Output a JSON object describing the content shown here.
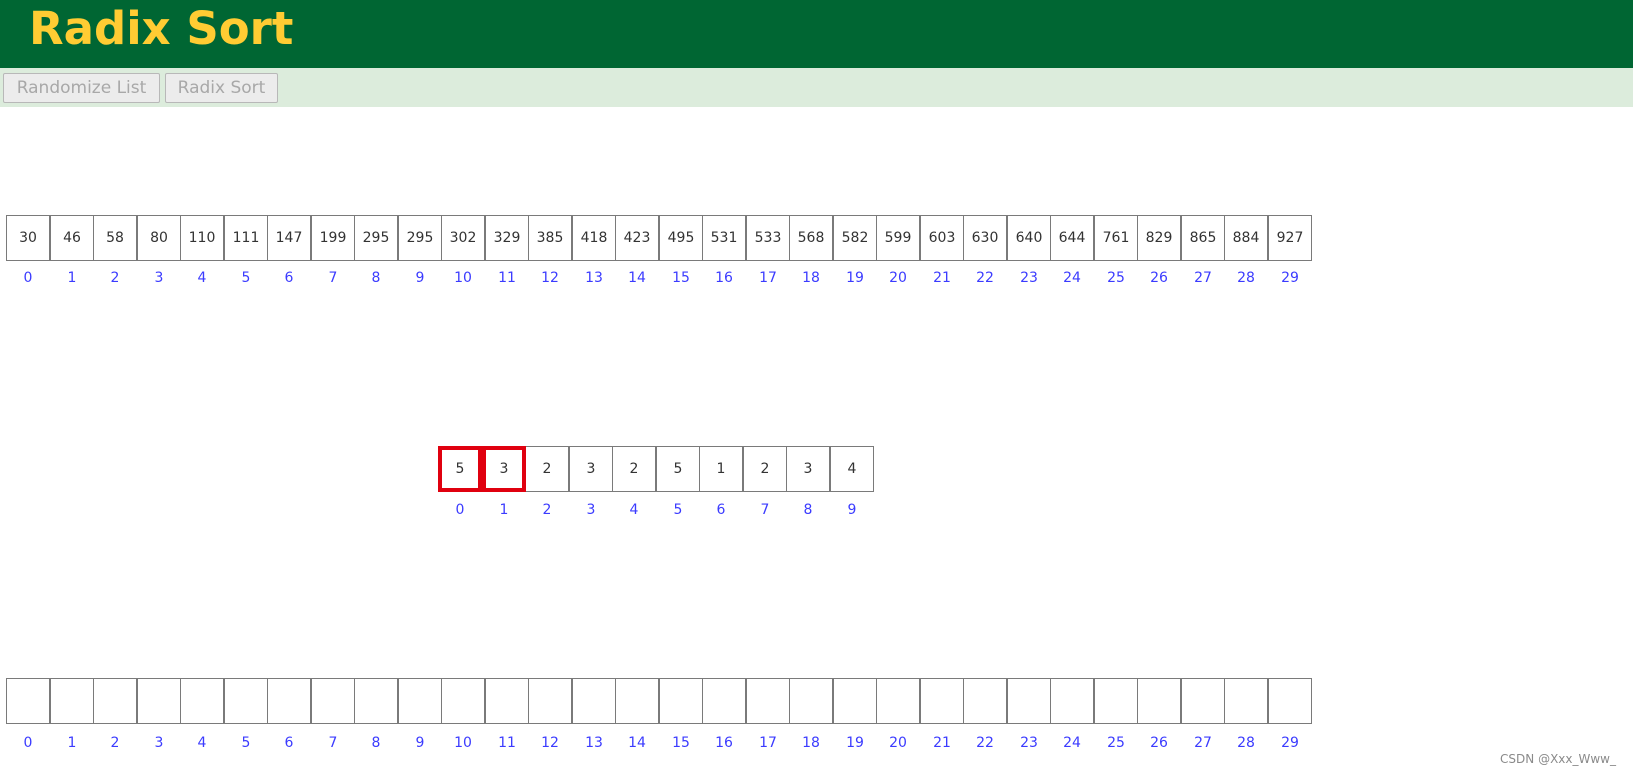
{
  "header": {
    "title": "Radix Sort"
  },
  "toolbar": {
    "randomize_label": "Randomize List",
    "sort_label": "Radix Sort"
  },
  "colors": {
    "header_bg": "#006633",
    "title_color": "#ffcc33",
    "toolbar_bg": "#dcecdc",
    "index_color": "#3b3bff",
    "highlight_border": "#e0000f"
  },
  "list_array": {
    "values": [
      "30",
      "46",
      "58",
      "80",
      "110",
      "111",
      "147",
      "199",
      "295",
      "295",
      "302",
      "329",
      "385",
      "418",
      "423",
      "495",
      "531",
      "533",
      "568",
      "582",
      "599",
      "603",
      "630",
      "640",
      "644",
      "761",
      "829",
      "865",
      "884",
      "927"
    ],
    "indices": [
      "0",
      "1",
      "2",
      "3",
      "4",
      "5",
      "6",
      "7",
      "8",
      "9",
      "10",
      "11",
      "12",
      "13",
      "14",
      "15",
      "16",
      "17",
      "18",
      "19",
      "20",
      "21",
      "22",
      "23",
      "24",
      "25",
      "26",
      "27",
      "28",
      "29"
    ]
  },
  "count_array": {
    "values": [
      "5",
      "3",
      "2",
      "3",
      "2",
      "5",
      "1",
      "2",
      "3",
      "4"
    ],
    "indices": [
      "0",
      "1",
      "2",
      "3",
      "4",
      "5",
      "6",
      "7",
      "8",
      "9"
    ],
    "highlighted_indices": [
      0,
      1
    ]
  },
  "output_array": {
    "values": [
      "",
      "",
      "",
      "",
      "",
      "",
      "",
      "",
      "",
      "",
      "",
      "",
      "",
      "",
      "",
      "",
      "",
      "",
      "",
      "",
      "",
      "",
      "",
      "",
      "",
      "",
      "",
      "",
      "",
      ""
    ],
    "indices": [
      "0",
      "1",
      "2",
      "3",
      "4",
      "5",
      "6",
      "7",
      "8",
      "9",
      "10",
      "11",
      "12",
      "13",
      "14",
      "15",
      "16",
      "17",
      "18",
      "19",
      "20",
      "21",
      "22",
      "23",
      "24",
      "25",
      "26",
      "27",
      "28",
      "29"
    ]
  },
  "watermark": "CSDN @Xxx_Www_"
}
